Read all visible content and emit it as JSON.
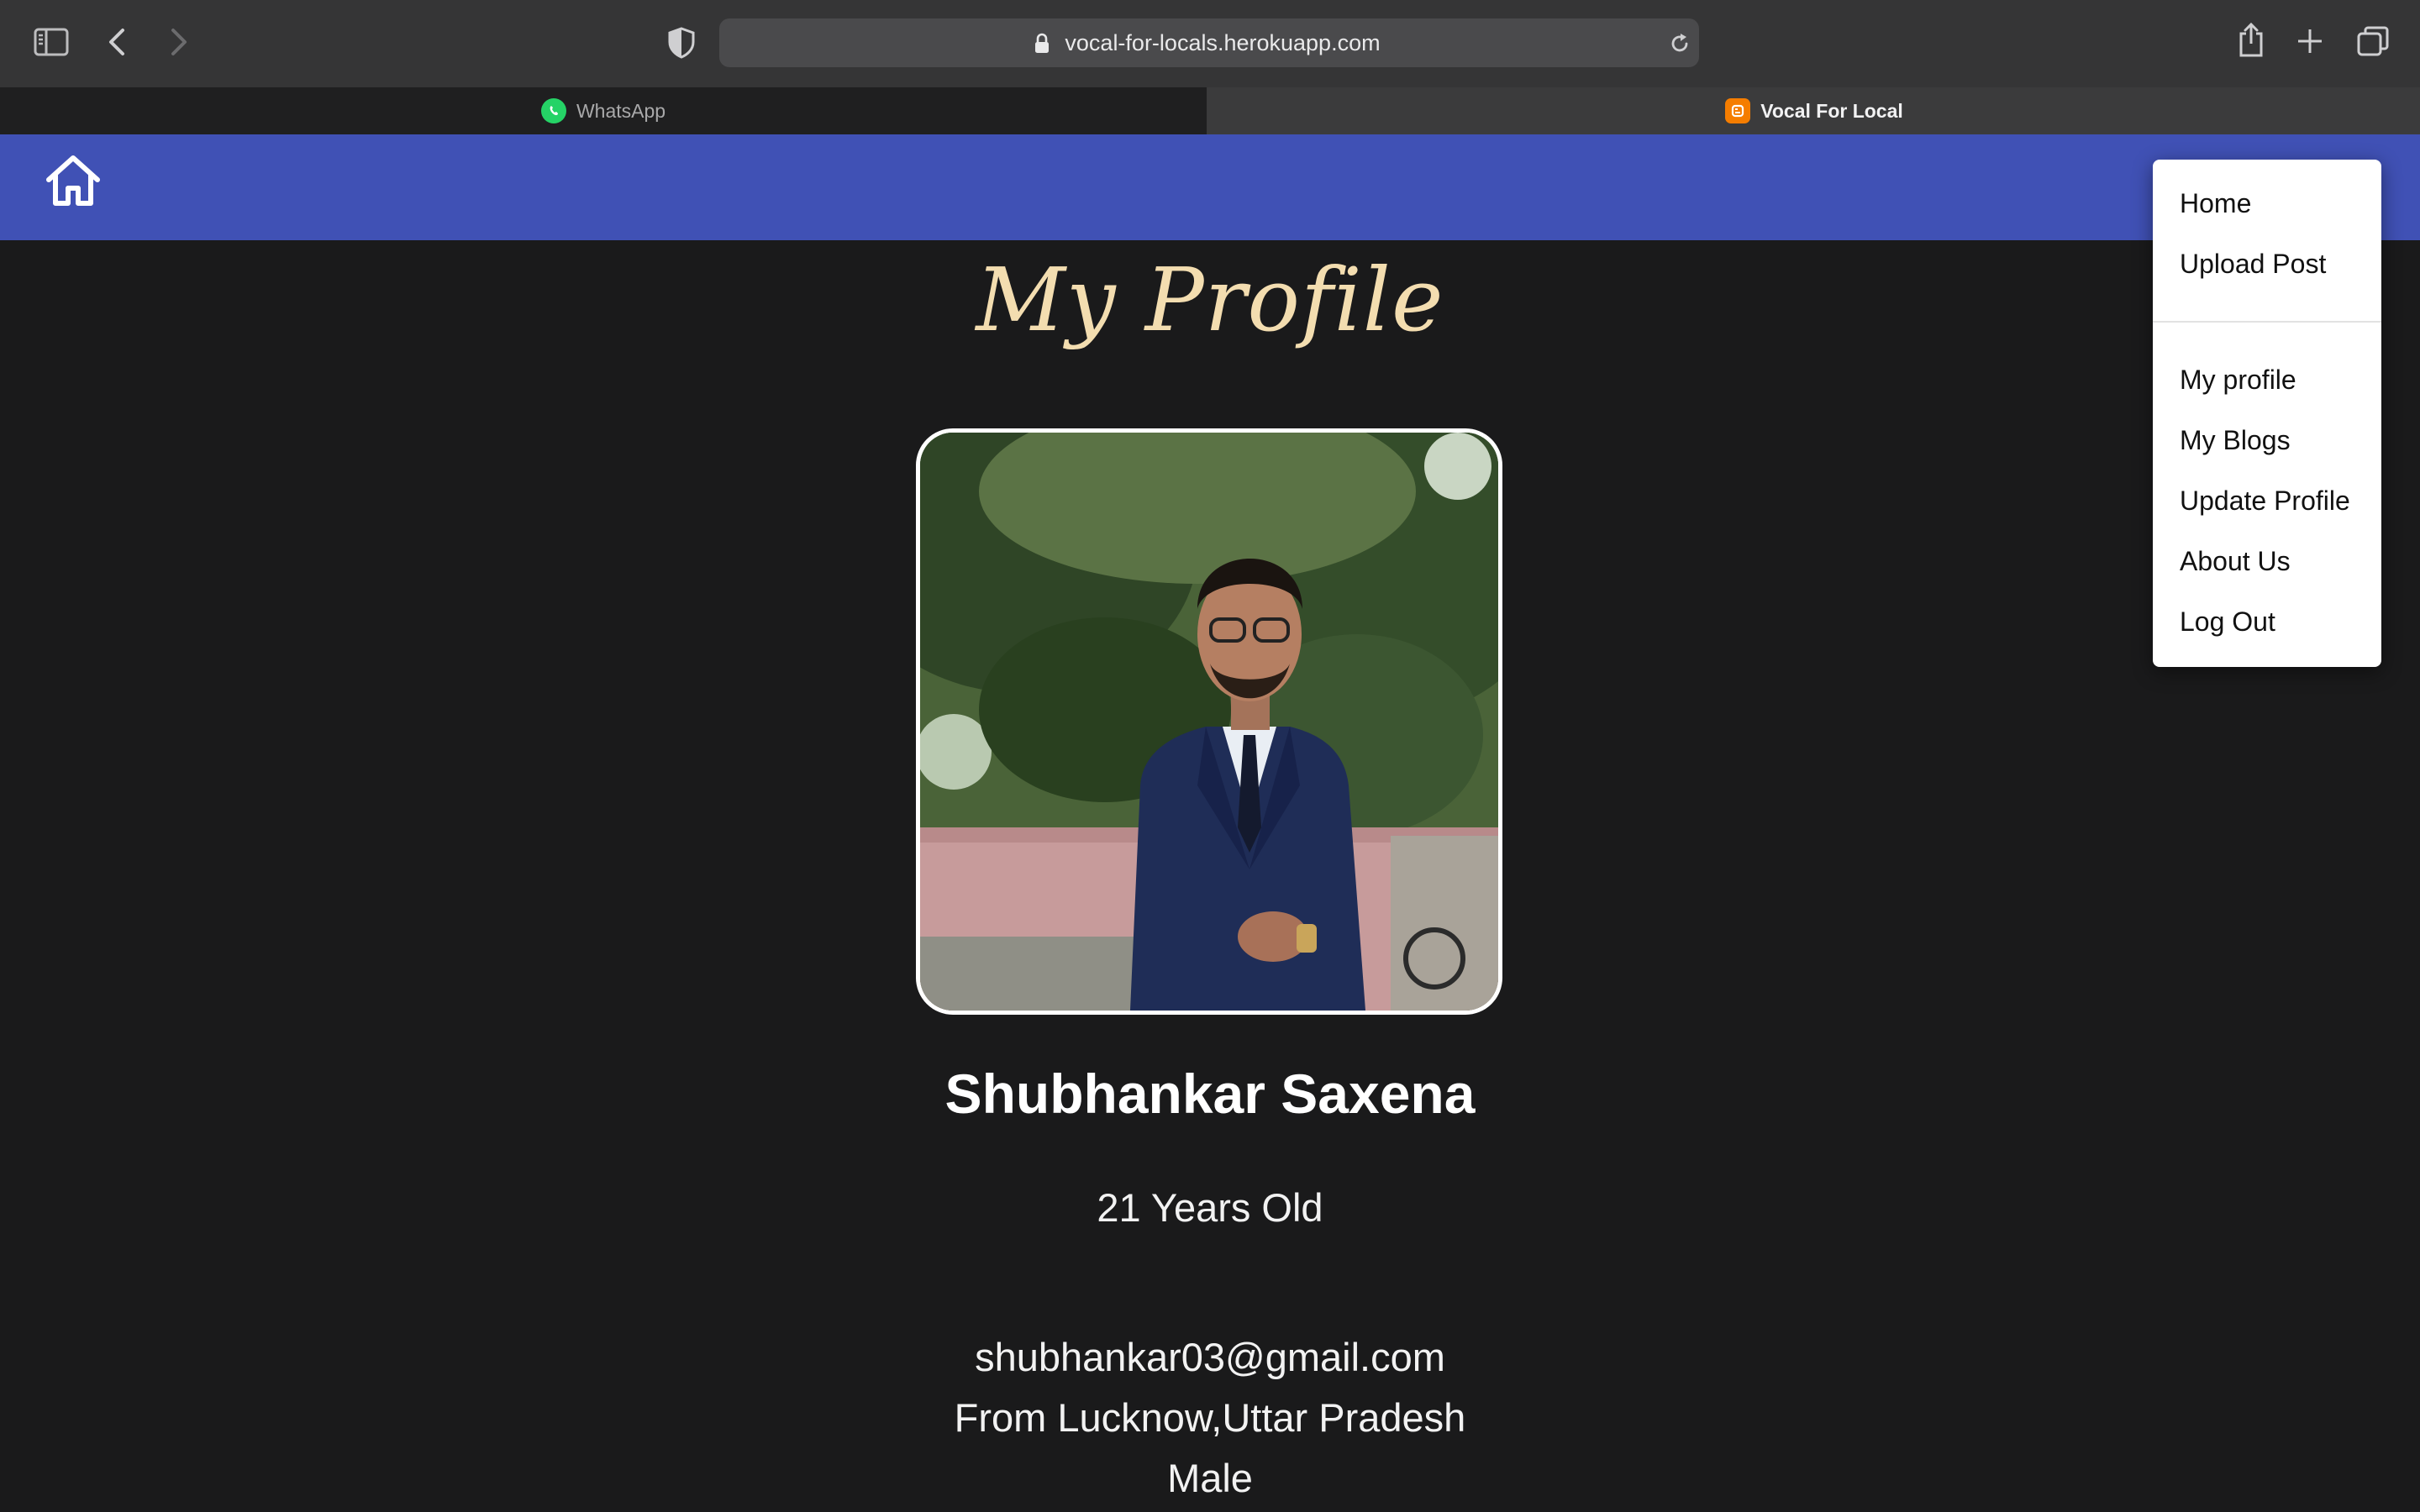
{
  "browser": {
    "url": "vocal-for-locals.herokuapp.com",
    "tabs": [
      {
        "label": "WhatsApp",
        "active": false,
        "favicon": "whatsapp-icon",
        "color": "#25d366"
      },
      {
        "label": "Vocal For Local",
        "active": true,
        "favicon": "blogger-icon",
        "color": "#f57d00"
      }
    ]
  },
  "navbar": {
    "color": "#4051b5",
    "home_icon": "home-icon"
  },
  "profile": {
    "heading": "My Profile",
    "name": "Shubhankar Saxena",
    "age": "21 Years Old",
    "email": "shubhankar03@gmail.com",
    "location": "From Lucknow,Uttar Pradesh",
    "gender": "Male"
  },
  "menu": {
    "items_top": [
      "Home",
      "Upload Post"
    ],
    "items_bottom": [
      "My profile",
      "My Blogs",
      "Update Profile",
      "About Us",
      "Log Out"
    ]
  }
}
